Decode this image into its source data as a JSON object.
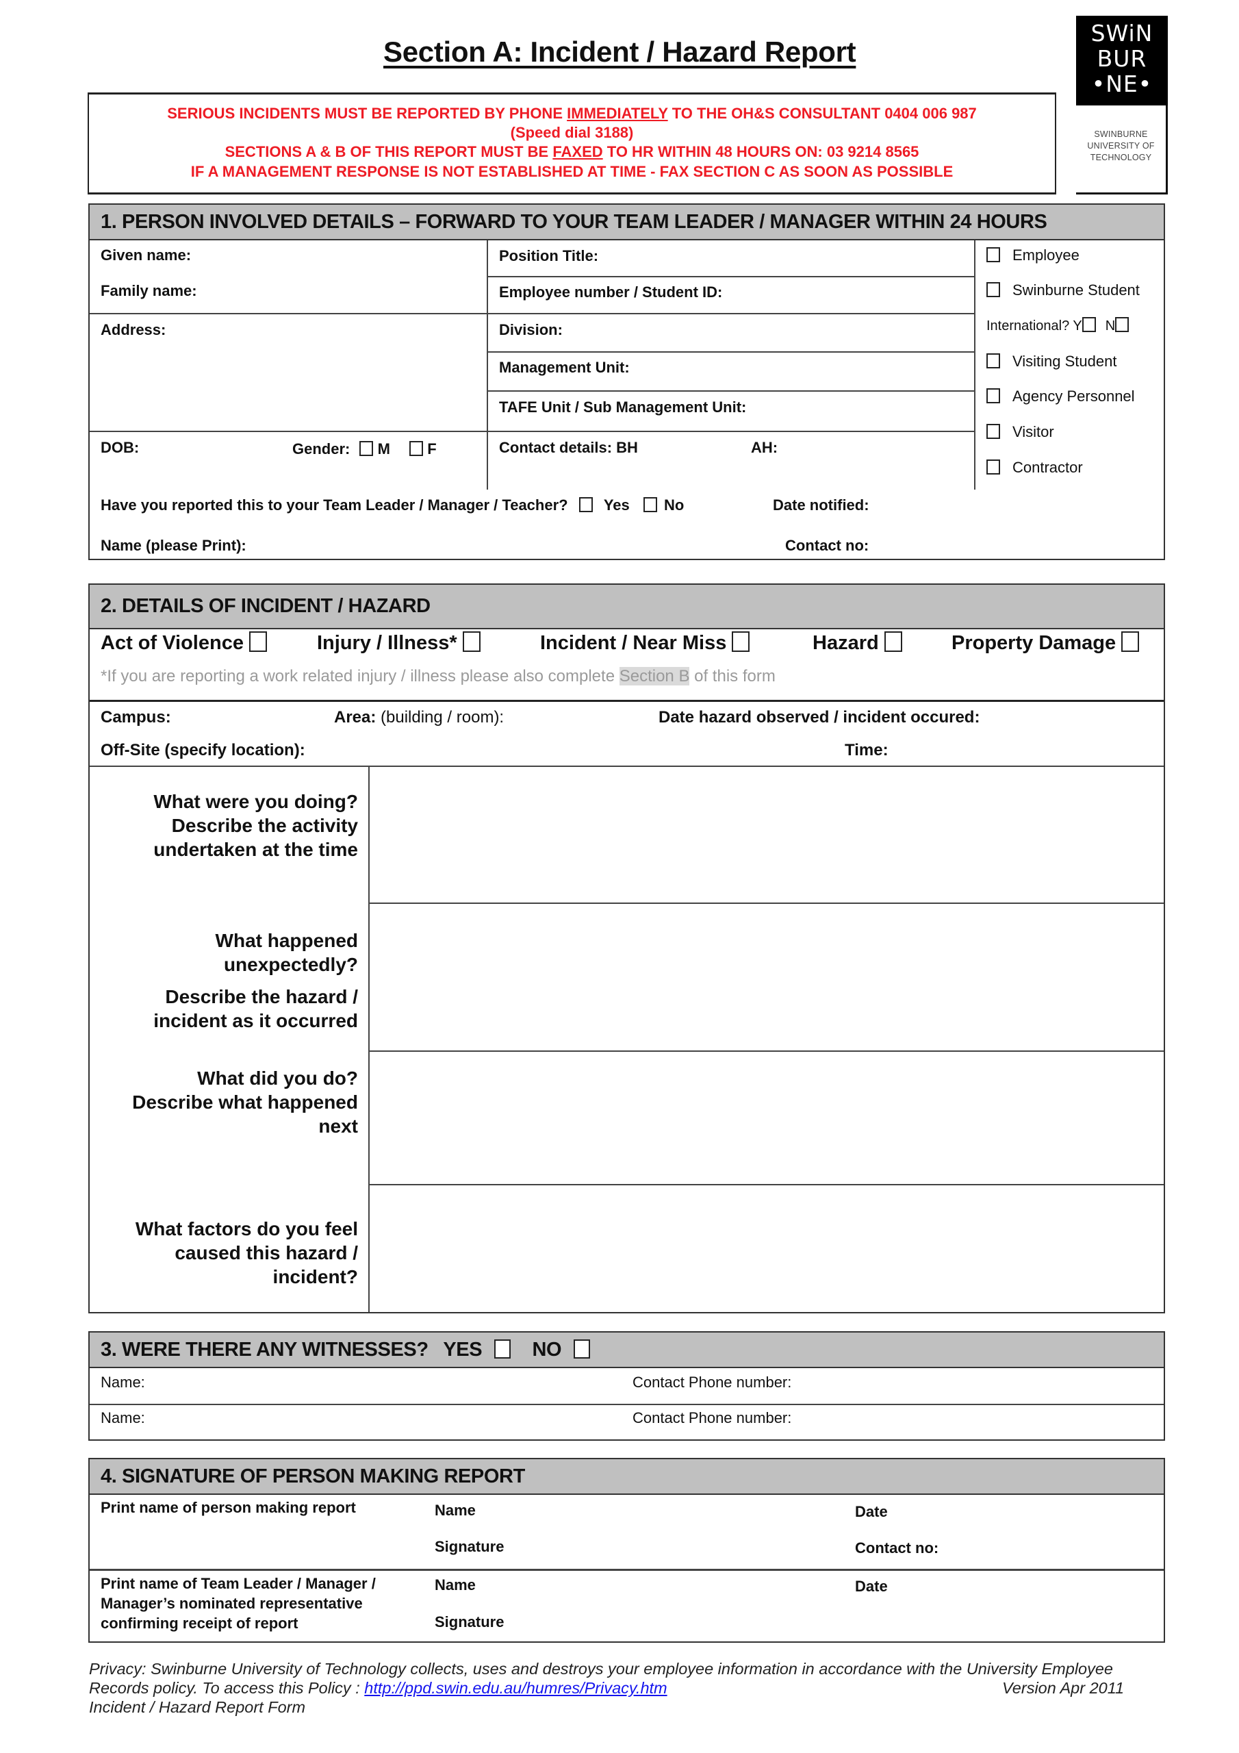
{
  "header": {
    "title": "Section A: Incident / Hazard Report",
    "notice": {
      "line1_pre": "SERIOUS INCIDENTS MUST BE REPORTED  BY PHONE ",
      "line1_emph": "IMMEDIATELY",
      "line1_post": " TO  THE OH&S CONSULTANT   0404 006 987",
      "line2": "(Speed dial 3188)",
      "line3_pre": "SECTIONS A & B OF THIS REPORT MUST BE ",
      "line3_emph": "FAXED",
      "line3_post": " TO HR WITHIN 48 HOURS ON: 03 9214 8565",
      "line4": "IF A MANAGEMENT RESPONSE IS NOT ESTABLISHED AT TIME - FAX SECTION C AS SOON AS POSSIBLE",
      "color": "#ee1c25"
    },
    "logo": {
      "mark": [
        "SWiN",
        "BUR",
        "•NE•"
      ],
      "sub": [
        "SWINBURNE",
        "UNIVERSITY OF",
        "TECHNOLOGY"
      ]
    }
  },
  "section1": {
    "heading": "1. PERSON INVOLVED DETAILS – FORWARD TO YOUR TEAM LEADER / MANAGER WITHIN 24 HOURS",
    "given_name": "Given name:",
    "family_name": "Family name:",
    "address": "Address:",
    "dob": "DOB:",
    "gender": "Gender:",
    "gender_m": "M",
    "gender_f": "F",
    "position_title": "Position Title:",
    "employee_number": "Employee number / Student ID:",
    "division": "Division:",
    "management_unit": "Management Unit:",
    "tafe_unit": "TAFE Unit / Sub Management Unit:",
    "contact_bh": "Contact details: BH",
    "contact_ah": "AH:",
    "person_types": [
      "Employee",
      "Swinburne Student",
      "Visiting Student",
      "Agency Personnel",
      "Visitor",
      "Contractor"
    ],
    "international": "International? Y",
    "international_n": "N",
    "reported_question": "Have you reported this to your Team Leader / Manager / Teacher?",
    "yes": "Yes",
    "no": "No",
    "date_notified": "Date notified:",
    "name_print": "Name (please Print):",
    "contact_no": "Contact no:"
  },
  "section2": {
    "heading": "2. DETAILS OF INCIDENT / HAZARD",
    "types": [
      "Act of  Violence",
      "Injury / Illness*",
      "Incident / Near Miss",
      "Hazard",
      "Property Damage"
    ],
    "note_pre": "*If you are reporting a work related injury / illness please also complete ",
    "note_hl": "Section B",
    "note_post": " of this form",
    "campus": "Campus:",
    "area_bold": "Area:",
    "area_rest": " (building / room):",
    "date_observed": "Date hazard observed / incident occured:",
    "offsite": "Off-Site (specify location):",
    "time": "Time:",
    "questions": [
      [
        "What were you doing?",
        "Describe the activity",
        "undertaken at the time"
      ],
      [
        "What happened",
        "unexpectedly?",
        "Describe the hazard /",
        "incident as it occurred"
      ],
      [
        "What did you do?",
        "Describe what happened",
        "next"
      ],
      [
        "What factors do you feel",
        "caused this hazard /",
        "incident?"
      ]
    ]
  },
  "section3": {
    "heading": "3. WERE THERE ANY WITNESSES?",
    "yes": "YES",
    "no": "NO",
    "rows": [
      {
        "name": "Name:",
        "phone": "Contact Phone number:"
      },
      {
        "name": "Name:",
        "phone": "Contact Phone number:"
      }
    ]
  },
  "section4": {
    "heading": "4. SIGNATURE OF PERSON MAKING REPORT",
    "row1_label": "Print name of person making report",
    "row2_label": [
      "Print name of Team Leader / Manager /",
      "Manager’s nominated representative",
      "confirming receipt of report"
    ],
    "name": "Name",
    "signature": "Signature",
    "date": "Date",
    "contact_no": "Contact no:"
  },
  "footer": {
    "line1": "Privacy: Swinburne University  of Technology collects, uses and destroys your employee information in accordance with the University Employee",
    "line2_pre": "Records policy.   To access this Policy : ",
    "link": "http://ppd.swin.edu.au/humres/Privacy.htm",
    "version": "Version Apr 2011",
    "line3": "Incident / Hazard Report Form"
  }
}
